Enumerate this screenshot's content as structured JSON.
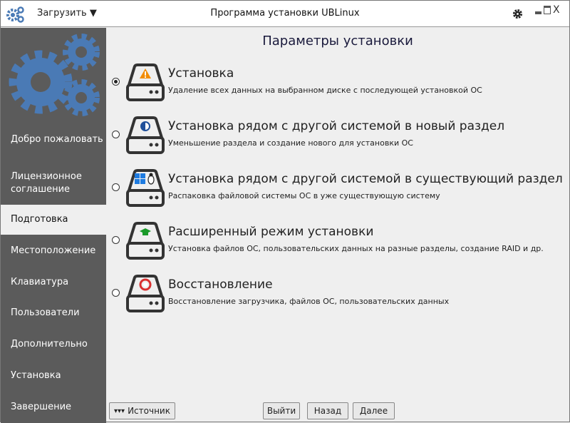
{
  "titlebar": {
    "menu_label": "Загрузить",
    "title": "Программа установки UBLinux"
  },
  "sidebar": {
    "items": [
      {
        "label": "Добро пожаловать",
        "active": false
      },
      {
        "label": "Лицензионное соглашение",
        "active": false
      },
      {
        "label": "Подготовка",
        "active": true
      },
      {
        "label": "Местоположение",
        "active": false
      },
      {
        "label": "Клавиатура",
        "active": false
      },
      {
        "label": "Пользователи",
        "active": false
      },
      {
        "label": "Дополнительно",
        "active": false
      },
      {
        "label": "Установка",
        "active": false
      },
      {
        "label": "Завершение",
        "active": false
      }
    ]
  },
  "main": {
    "heading": "Параметры установки",
    "options": [
      {
        "title": "Установка",
        "desc": "Удаление всех данных на выбранном диске с последующей установкой ОС",
        "icon": "warning-icon",
        "selected": true
      },
      {
        "title": "Установка рядом с другой системой в новый раздел",
        "desc": "Уменьшение раздела и создание нового для установки ОС",
        "icon": "half-circle-icon",
        "selected": false
      },
      {
        "title": "Установка рядом с другой системой в существующий раздел",
        "desc": "Распаковка файловой системы ОС в уже существующую систему",
        "icon": "windows-linux-icon",
        "selected": false
      },
      {
        "title": "Расширенный режим установки",
        "desc": "Установка файлов ОС, пользовательских данных на разные разделы, создание RAID и др.",
        "icon": "graduation-cap-icon",
        "selected": false
      },
      {
        "title": "Восстановление",
        "desc": "Восстановление загрузчика, файлов ОС, пользовательских данных",
        "icon": "lifebuoy-icon",
        "selected": false
      }
    ]
  },
  "footer": {
    "source": "Источник",
    "exit": "Выйти",
    "back": "Назад",
    "next": "Далее"
  },
  "colors": {
    "sidebar": "#5b5b5b",
    "accent": "#4a7ab5",
    "warning": "#f28c00"
  }
}
